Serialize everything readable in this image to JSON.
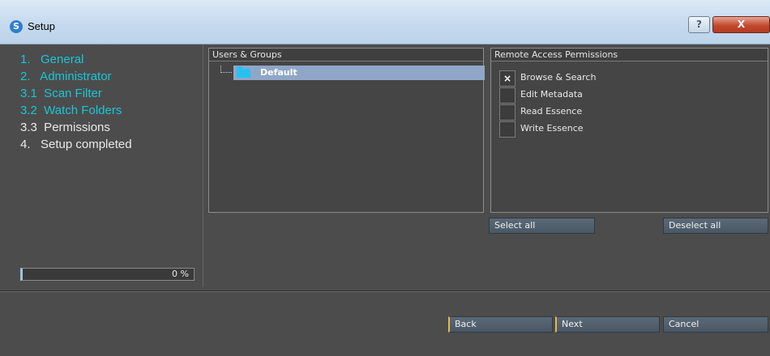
{
  "window": {
    "title": "Setup",
    "app_icon_glyph": "S",
    "help_glyph": "?",
    "close_glyph": "X"
  },
  "steps": [
    {
      "label": "1.   General",
      "state": "done"
    },
    {
      "label": "2.   Administrator",
      "state": "done"
    },
    {
      "label": "3.1  Scan Filter",
      "state": "done"
    },
    {
      "label": "3.2  Watch Folders",
      "state": "done"
    },
    {
      "label": "3.3  Permissions",
      "state": "current"
    },
    {
      "label": "4.   Setup completed",
      "state": "pending"
    }
  ],
  "progress": {
    "value": 0,
    "text": "0 %"
  },
  "users_panel": {
    "header": "Users & Groups",
    "items": [
      {
        "label": "Default",
        "icon": "folder-icon",
        "selected": true
      }
    ]
  },
  "permissions_panel": {
    "header": "Remote Access Permissions",
    "items": [
      {
        "label": "Browse & Search",
        "checked": true
      },
      {
        "label": "Edit Metadata",
        "checked": false
      },
      {
        "label": "Read Essence",
        "checked": false
      },
      {
        "label": "Write Essence",
        "checked": false
      }
    ],
    "check_glyph": "×"
  },
  "buttons": {
    "select_all": "Select all",
    "deselect_all": "Deselect all",
    "back": "Back",
    "next": "Next",
    "cancel": "Cancel"
  },
  "colors": {
    "done_step": "#18c6d8",
    "current_step": "#eaeaea",
    "selection": "#8fa6c8",
    "button_accent": "#e7b84a"
  }
}
